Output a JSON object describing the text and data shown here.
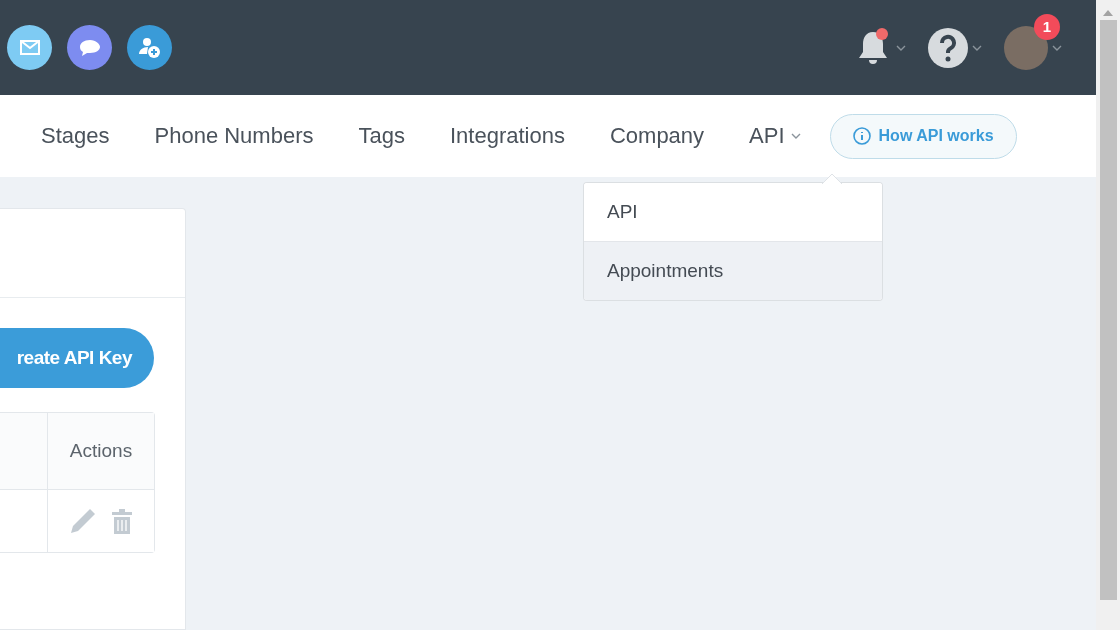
{
  "header": {
    "apps": [
      {
        "kind": "mail",
        "color": "#7ecbf3"
      },
      {
        "kind": "chat",
        "color": "#7d8cf0"
      },
      {
        "kind": "add-user",
        "color": "#3a9bd8"
      }
    ],
    "notifications": {
      "unread": true
    },
    "profile": {
      "badge": "1"
    }
  },
  "nav": {
    "items": [
      {
        "label": "Stages",
        "kind": "link"
      },
      {
        "label": "Phone Numbers",
        "kind": "link"
      },
      {
        "label": "Tags",
        "kind": "link"
      },
      {
        "label": "Integrations",
        "kind": "link"
      },
      {
        "label": "Company",
        "kind": "link"
      },
      {
        "label": "API",
        "kind": "menu"
      }
    ],
    "help_button": "How API works"
  },
  "dropdown": {
    "items": [
      {
        "label": "API",
        "selected": false
      },
      {
        "label": "Appointments",
        "selected": true
      }
    ]
  },
  "card": {
    "button": "reate API Key",
    "table": {
      "columns": [
        "Actions"
      ],
      "rows": [
        {
          "editable": true,
          "deletable": true
        }
      ]
    }
  }
}
